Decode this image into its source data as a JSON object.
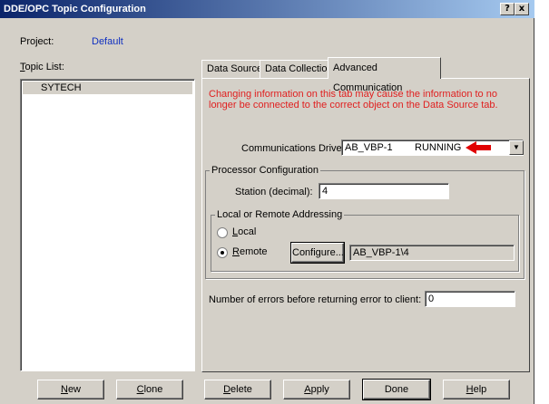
{
  "window": {
    "title": "DDE/OPC Topic Configuration",
    "help_btn": "?",
    "close_btn": "x"
  },
  "project": {
    "label": "Project:",
    "value": "Default"
  },
  "topic_list": {
    "label": "Topic List:",
    "items": [
      "SYTECH"
    ]
  },
  "tabs": [
    "Data Source",
    "Data Collection",
    "Advanced Communication"
  ],
  "advanced": {
    "warning": "Changing information on this tab may cause the information to no longer be connected to the correct object on the Data Source tab.",
    "driver_label": "Communications Driver:",
    "driver_value": "AB_VBP-1        RUNNING",
    "processor_group": "Processor Configuration",
    "station_label": "Station (decimal):",
    "station_value": "4",
    "addressing_group": "Local or Remote Addressing",
    "local_label": "Local",
    "remote_label": "Remote",
    "configure_label": "Configure...",
    "remote_path": "AB_VBP-1\\4",
    "errors_label": "Number of errors before returning error to client:",
    "errors_value": "0"
  },
  "buttons": {
    "new": "New",
    "clone": "Clone",
    "delete": "Delete",
    "apply": "Apply",
    "done": "Done",
    "help": "Help"
  },
  "colors": {
    "arrow": "#e00000",
    "warning_text": "#e02020",
    "project_value": "#1030c0"
  }
}
